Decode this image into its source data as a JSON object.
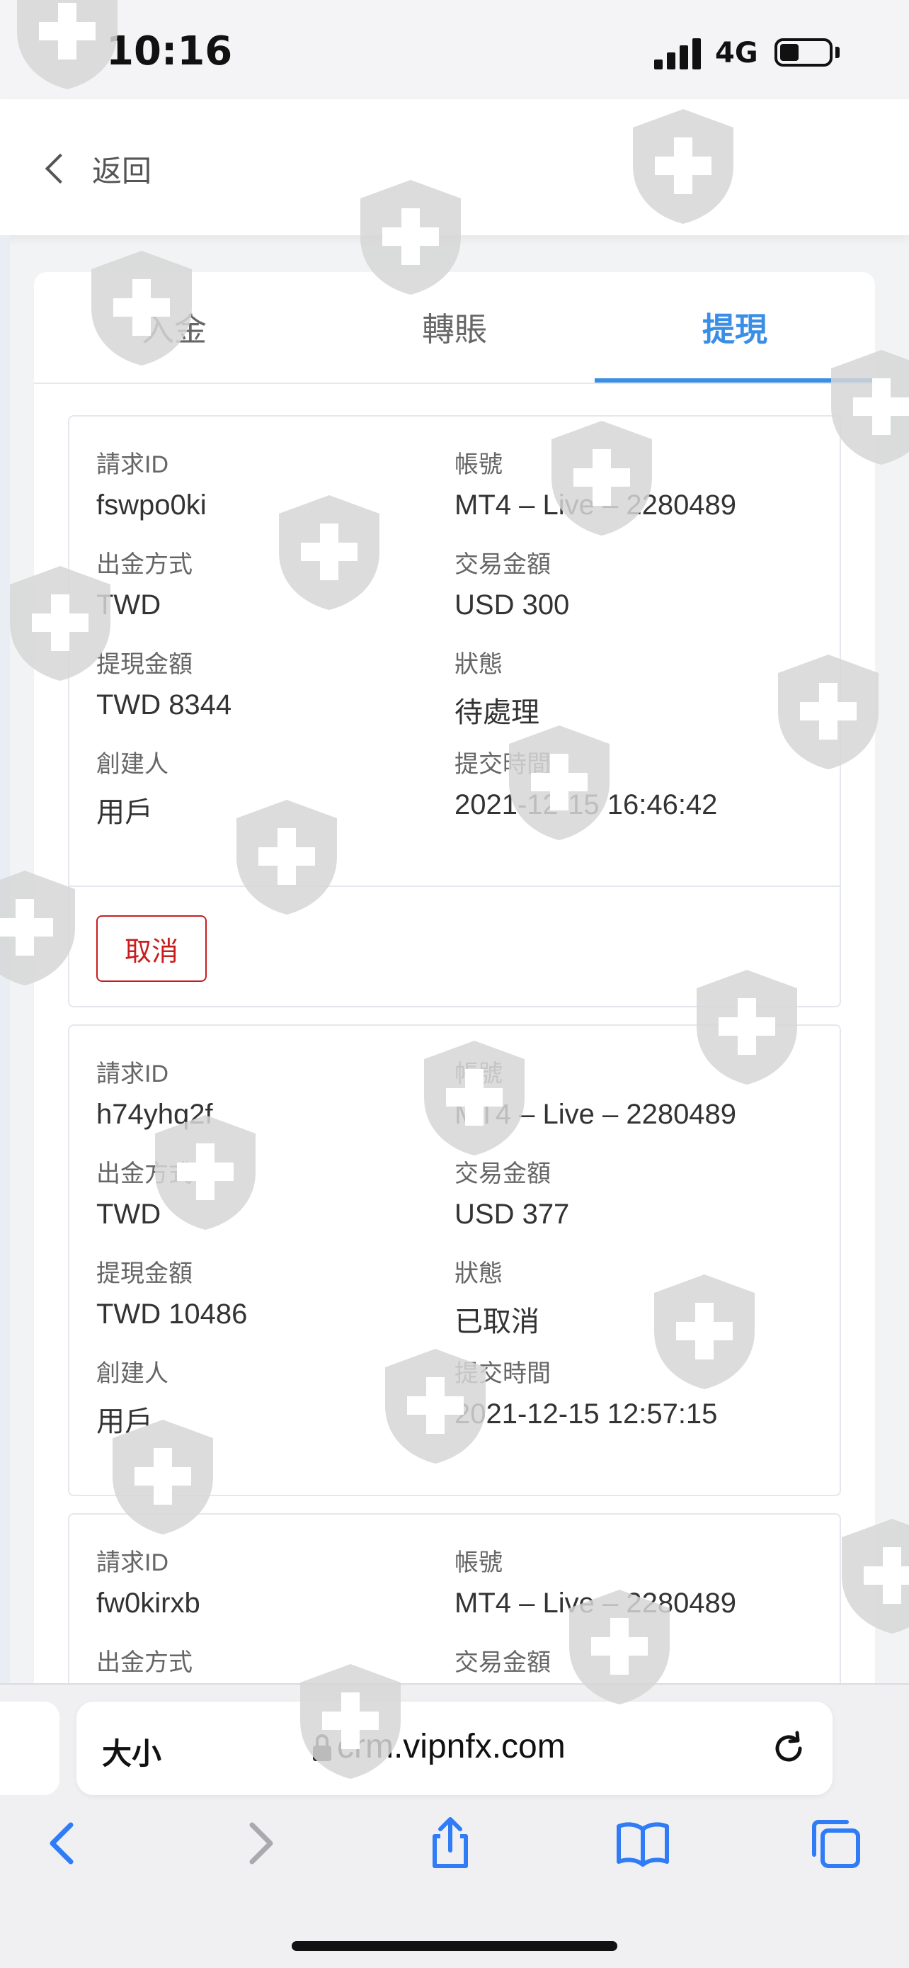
{
  "status_bar": {
    "time": "10:16",
    "network": "4G",
    "signal_bars": 4,
    "battery_level": 0.3
  },
  "nav": {
    "back_label": "返回"
  },
  "tabs": [
    {
      "label": "入金",
      "active": false
    },
    {
      "label": "轉賬",
      "active": false
    },
    {
      "label": "提現",
      "active": true
    }
  ],
  "records": [
    {
      "request_id_label": "請求ID",
      "request_id": "fswpo0ki",
      "account_label": "帳號",
      "account": "MT4 – Live – 2280489",
      "method_label": "出金方式",
      "method": "TWD",
      "trade_amount_label": "交易金額",
      "trade_amount": "USD 300",
      "withdraw_amount_label": "提現金額",
      "withdraw_amount": "TWD 8344",
      "status_label": "狀態",
      "status": "待處理",
      "creator_label": "創建人",
      "creator": "用戶",
      "submitted_label": "提交時間",
      "submitted": "2021-12-15 16:46:42",
      "cancel_label": "取消"
    },
    {
      "request_id_label": "請求ID",
      "request_id": "h74yhq2f",
      "account_label": "帳號",
      "account": "MT4 – Live – 2280489",
      "method_label": "出金方式",
      "method": "TWD",
      "trade_amount_label": "交易金額",
      "trade_amount": "USD 377",
      "withdraw_amount_label": "提現金額",
      "withdraw_amount": "TWD 10486",
      "status_label": "狀態",
      "status": "已取消",
      "creator_label": "創建人",
      "creator": "用戶",
      "submitted_label": "提交時間",
      "submitted": "2021-12-15 12:57:15"
    },
    {
      "request_id_label": "請求ID",
      "request_id": "fw0kirxb",
      "account_label": "帳號",
      "account": "MT4 – Live – 2280489",
      "method_label": "出金方式",
      "trade_amount_label": "交易金額"
    }
  ],
  "browser": {
    "text_size_label": "大小",
    "url": "crm.vipnfx.com"
  },
  "colors": {
    "accent": "#3a8ee6",
    "danger": "#c81e1e",
    "watermark": "#d6d6d6"
  }
}
